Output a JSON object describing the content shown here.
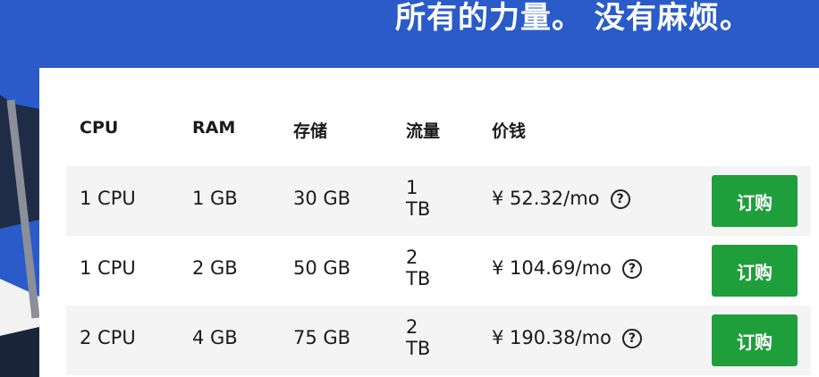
{
  "hero": {
    "title": "所有的力量。 没有麻烦。"
  },
  "table": {
    "headers": [
      "CPU",
      "RAM",
      "存储",
      "流量",
      "价钱"
    ],
    "rows": [
      {
        "cpu": "1 CPU",
        "ram": "1 GB",
        "storage": "30 GB",
        "traffic": "1 TB",
        "price": "¥ 52.32/mo",
        "button": "订购"
      },
      {
        "cpu": "1 CPU",
        "ram": "2 GB",
        "storage": "50 GB",
        "traffic": "2 TB",
        "price": "¥ 104.69/mo",
        "button": "订购"
      },
      {
        "cpu": "2 CPU",
        "ram": "4 GB",
        "storage": "75 GB",
        "traffic": "2 TB",
        "price": "¥ 190.38/mo",
        "button": "订购"
      }
    ]
  },
  "help_icon_glyph": "?",
  "colors": {
    "hero_bg": "#2a5bc9",
    "button_bg": "#1f9e3c",
    "row_bg": "#f4f4f5"
  }
}
